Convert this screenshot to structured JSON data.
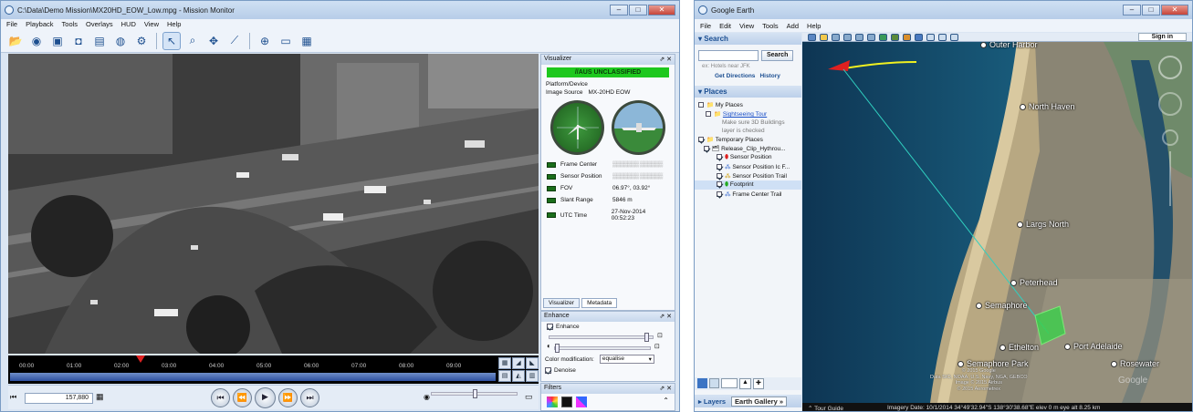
{
  "mission_monitor": {
    "title": "C:\\Data\\Demo Mission\\MX20HD_EOW_Low.mpg - Mission Monitor",
    "menu": [
      "File",
      "Playback",
      "Tools",
      "Overlays",
      "HUD",
      "View",
      "Help"
    ],
    "visualizer": {
      "header": "Visualizer",
      "classification": "//AUS UNCLASSIFIED",
      "platform_label": "Platform/Device",
      "image_source_label": "Image Source",
      "image_source_value": "MX-20HD EOW",
      "rows": [
        {
          "label": "Frame Center",
          "value": "▒▒▒▒▒▒▒ ▒▒▒▒▒▒"
        },
        {
          "label": "Sensor Position",
          "value": "▒▒▒▒▒▒▒ ▒▒▒▒▒▒"
        },
        {
          "label": "FOV",
          "value": "06.97°, 03.92°"
        },
        {
          "label": "Slant Range",
          "value": "5846 m"
        },
        {
          "label": "UTC Time",
          "value": "27-Nov-2014 00:52:23"
        }
      ],
      "tabs": [
        "Visualizer",
        "Metadata"
      ]
    },
    "enhance": {
      "header": "Enhance",
      "enhance_label": "Enhance",
      "color_mod_label": "Color modification:",
      "color_mod_value": "equalise",
      "denoise_label": "Denoise"
    },
    "filters_header": "Filters",
    "timeline_ticks": [
      "00:00",
      "01:00",
      "02:00",
      "03:00",
      "04:00",
      "05:00",
      "06:00",
      "07:00",
      "08:00",
      "09:00"
    ],
    "frame_number": "157,880"
  },
  "google_earth": {
    "title": "Google Earth",
    "menu": [
      "File",
      "Edit",
      "View",
      "Tools",
      "Add",
      "Help"
    ],
    "search_header": "Search",
    "search_button": "Search",
    "search_hint": "ex: Hotels near JFK",
    "get_directions": "Get Directions",
    "history": "History",
    "places_header": "Places",
    "places": [
      {
        "label": "My Places",
        "level": 0
      },
      {
        "label": "Sightseeing Tour",
        "level": 1,
        "link": true
      },
      {
        "label": "Make sure 3D Buildings",
        "level": 2,
        "grey": true
      },
      {
        "label": "layer is checked",
        "level": 2,
        "grey": true
      },
      {
        "label": "Temporary Places",
        "level": 0
      },
      {
        "label": "Release_Clip_Hythrou...",
        "level": 1
      },
      {
        "label": "Sensor Position",
        "level": 2
      },
      {
        "label": "Sensor Position Ic F...",
        "level": 2
      },
      {
        "label": "Sensor Position Trail",
        "level": 2
      },
      {
        "label": "Footprint",
        "level": 2
      },
      {
        "label": "Frame Center Trail",
        "level": 2
      }
    ],
    "layers_label": "Layers",
    "earth_gallery": "Earth Gallery",
    "sign_in": "Sign in",
    "tour_guide": "Tour Guide",
    "map_labels": [
      "Outer Harbor",
      "North Haven",
      "Largs North",
      "Peterhead",
      "Semaphore",
      "Ethelton",
      "Port Adelaide",
      "Semaphore Park",
      "Rosewater"
    ],
    "attribution": [
      "© 2015 Google",
      "Data SIO, NOAA, U.S. Navy, NGA, GEBCO",
      "Image © 2015 Airbus",
      "© 2015 Aerometrex"
    ],
    "google_logo": "Google",
    "status": "Imagery Date: 10/1/2014   34°49'32.94\"S 138°30'38.68\"E elev  0 m   eye alt  8.25 km"
  },
  "colors": {
    "classification_green": "#1ec81e",
    "footprint_green": "#3ad04a",
    "sensor_trail_yellow": "#f0f020",
    "sensor_red": "#e02020"
  }
}
